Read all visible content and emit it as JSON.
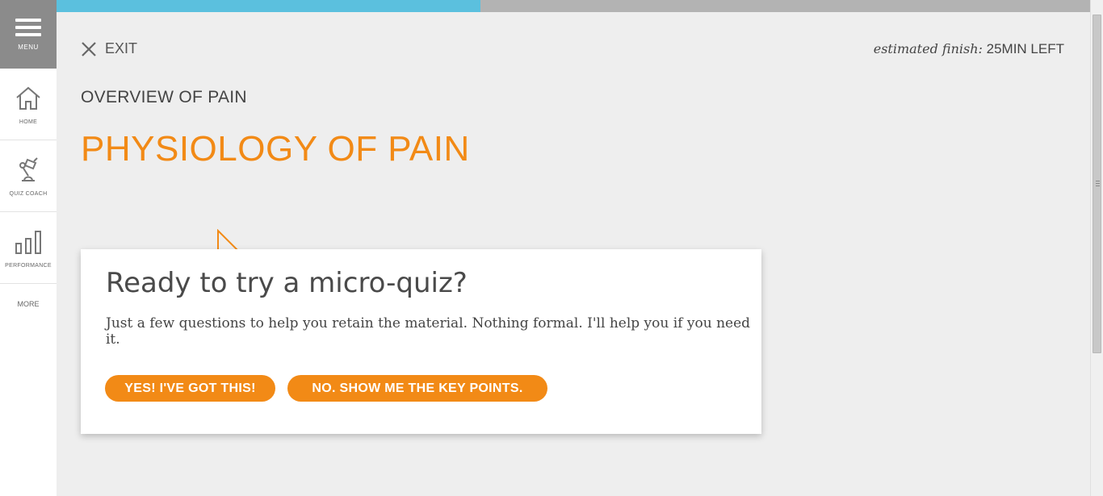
{
  "progress": {
    "fraction": 0.41
  },
  "sidebar": {
    "menu_label": "MENU",
    "items": [
      {
        "label": "HOME",
        "icon": "home-icon"
      },
      {
        "label": "QUIZ COACH",
        "icon": "quiz-coach-icon"
      },
      {
        "label": "PERFORMANCE",
        "icon": "bar-chart-icon"
      }
    ],
    "more_label": "MORE"
  },
  "header": {
    "exit_label": "EXIT",
    "finish_prefix": "estimated finish:",
    "finish_value": "25MIN LEFT"
  },
  "lesson": {
    "section": "OVERVIEW OF PAIN",
    "title": "PHYSIOLOGY OF PAIN"
  },
  "quiz_card": {
    "heading": "Ready to try a micro-quiz?",
    "body": "Just a few questions to help you retain the material. Nothing formal. I'll help you if you need it.",
    "yes_label": "YES! I'VE GOT THIS!",
    "no_label": "NO. SHOW ME THE KEY POINTS."
  },
  "colors": {
    "accent": "#f28a16",
    "progress": "#5bc0de",
    "menu_bg": "#8b8b8b",
    "page_bg": "#eeeeee"
  }
}
